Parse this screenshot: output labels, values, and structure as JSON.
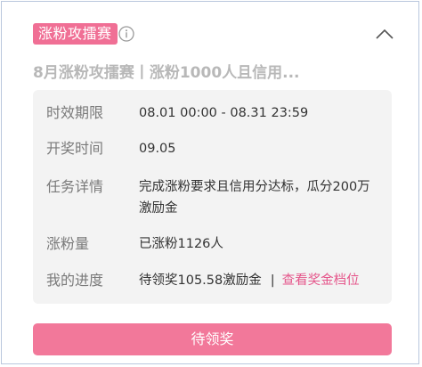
{
  "header": {
    "badge": "涨粉攻擂赛",
    "info_icon": "info-circle-icon",
    "collapse_icon": "chevron-up-icon"
  },
  "task": {
    "title": "8月涨粉攻擂赛丨涨粉1000人且信用..."
  },
  "details": {
    "period_label": "时效期限",
    "period_value": "08.01 00:00 - 08.31 23:59",
    "draw_label": "开奖时间",
    "draw_value": "09.05",
    "task_label": "任务详情",
    "task_value": "完成涨粉要求且信用分达标，瓜分200万激励金",
    "fans_label": "涨粉量",
    "fans_value": "已涨粉1126人",
    "progress_label": "我的进度",
    "progress_value": "待领奖105.58激励金",
    "progress_separator": "|",
    "progress_link": "查看奖金档位"
  },
  "action": {
    "button_label": "待领奖"
  },
  "colors": {
    "accent": "#f06f95",
    "link": "#e5568b",
    "button": "#f2789a",
    "panel": "#f3f3f3"
  }
}
